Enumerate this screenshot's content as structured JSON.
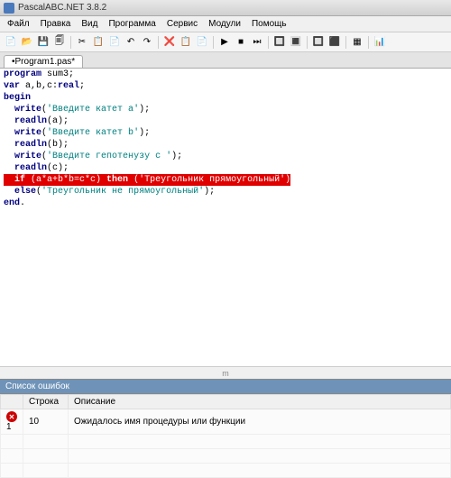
{
  "title": "PascalABC.NET 3.8.2",
  "menu": [
    "Файл",
    "Правка",
    "Вид",
    "Программа",
    "Сервис",
    "Модули",
    "Помощь"
  ],
  "toolbar_icons": [
    "📄",
    "📂",
    "💾",
    "🗐",
    "",
    "✂",
    "📋",
    "📄",
    "↶",
    "↷",
    "",
    "❌",
    "📋",
    "📄",
    "",
    "▶",
    "■",
    "⏭",
    "",
    "🔲",
    "🔳",
    "",
    "🔲",
    "⬛",
    "",
    "▦",
    "",
    "📊"
  ],
  "tab": "•Program1.pas*",
  "code": [
    {
      "t": "program sum3;"
    },
    {
      "t": "var a,b,c:real;"
    },
    {
      "t": "begin"
    },
    {
      "t": "  write('Введите катет a');"
    },
    {
      "t": "  readln(a);"
    },
    {
      "t": "  write('Введите катет b');"
    },
    {
      "t": "  readln(b);"
    },
    {
      "t": "  write('Введите гепотенузу c ');"
    },
    {
      "t": "  readln(c);"
    },
    {
      "t": "  if (a*a+b*b=c*c) then ('Треугольник прямоугольный')",
      "err": true
    },
    {
      "t": "  else('Треугольник не прямоугольный');"
    },
    {
      "t": "end."
    }
  ],
  "scroll_marker": "m",
  "err_panel": {
    "title": "Список ошибок",
    "cols": [
      "",
      "Строка",
      "Описание"
    ],
    "rows": [
      {
        "icon": "✖",
        "line": "10",
        "col": "1",
        "desc": "Ожидалось имя процедуры или функции"
      }
    ]
  }
}
